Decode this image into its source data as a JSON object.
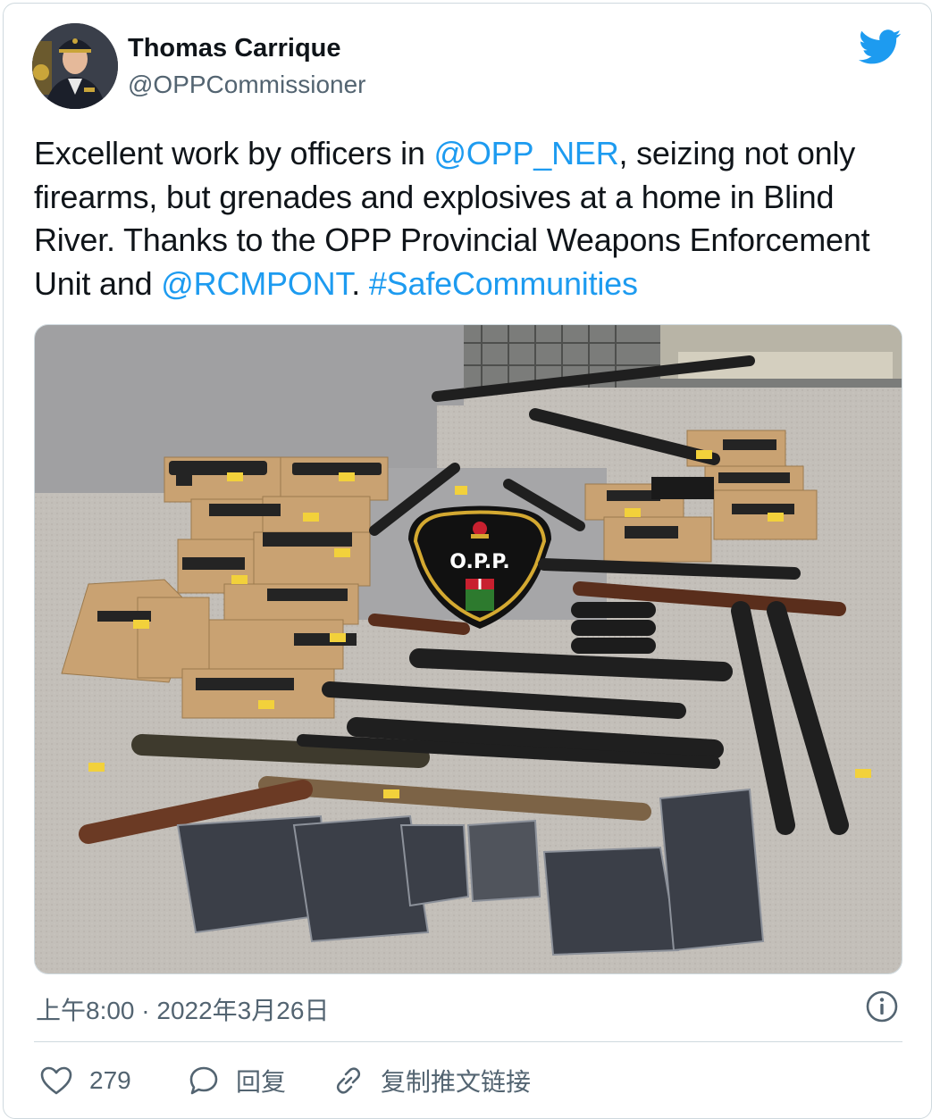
{
  "author": {
    "name": "Thomas Carrique",
    "handle": "@OPPCommissioner"
  },
  "tweet": {
    "segments": [
      {
        "text": "Excellent work by officers in ",
        "link": false
      },
      {
        "text": "@OPP_NER",
        "link": true
      },
      {
        "text": ", seizing not only firearms, but grenades and explosives at a home in Blind River. Thanks to the OPP Provincial Weapons Enforcement Unit and ",
        "link": false
      },
      {
        "text": "@RCMPONT",
        "link": true
      },
      {
        "text": ". ",
        "link": false
      },
      {
        "text": "#SafeCommunities",
        "link": true
      }
    ]
  },
  "photo": {
    "logo_text": "O.P.P."
  },
  "meta": {
    "timestamp": "上午8:00 · 2022年3月26日"
  },
  "actions": {
    "like_count": "279",
    "reply_label": "回复",
    "copy_link_label": "复制推文链接"
  },
  "colors": {
    "link": "#1d9bf0",
    "text": "#0f1419",
    "secondary": "#536471",
    "border": "#cfd9de"
  },
  "icons": [
    "twitter-bird-icon",
    "info-icon",
    "heart-icon",
    "reply-bubble-icon",
    "link-icon"
  ]
}
